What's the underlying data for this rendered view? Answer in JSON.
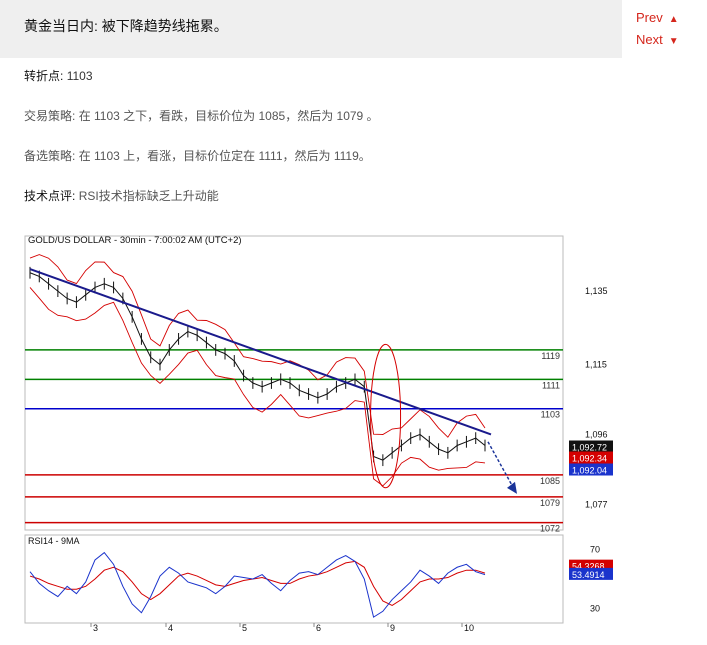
{
  "header": {
    "title": "黄金当日内: 被下降趋势线拖累。"
  },
  "nav": {
    "prev": "Prev",
    "next": "Next"
  },
  "pivot": {
    "label": "转折点:",
    "value": "1103"
  },
  "strategy": {
    "label": "交易策略:",
    "text": "在 1103 之下，看跌，目标价位为 1085，然后为 1079 。"
  },
  "alternative": {
    "label": "备选策略:",
    "text": "在 1103 上，看涨，目标价位定在 1111，然后为 1119。"
  },
  "comment": {
    "label": "技术点评:",
    "text": "RSI技术指标缺乏上升动能"
  },
  "chart_data": {
    "type": "line",
    "title": "GOLD/US DOLLAR - 30min - 7:00:02 AM (UTC+2)",
    "x_ticks": [
      "3",
      "4",
      "5",
      "6",
      "9",
      "10"
    ],
    "y_ticks": [
      1135,
      1115,
      1096,
      1077
    ],
    "ylim": [
      1070,
      1150
    ],
    "levels": [
      {
        "value": 1119,
        "label": "1119",
        "color": "#008000"
      },
      {
        "value": 1111,
        "label": "1111",
        "color": "#008000"
      },
      {
        "value": 1103,
        "label": "1103",
        "color": "#0000cc"
      },
      {
        "value": 1085,
        "label": "1085",
        "color": "#cc0000"
      },
      {
        "value": 1079,
        "label": "1079",
        "color": "#cc0000"
      },
      {
        "value": 1072,
        "label": "1072",
        "color": "#cc0000"
      }
    ],
    "price_tags": [
      {
        "value": 1092.72,
        "label": "1,092.72",
        "color": "#111111"
      },
      {
        "value": 1092.34,
        "label": "1,092.34",
        "color": "#d40000"
      },
      {
        "value": 1092.04,
        "label": "1,092.04",
        "color": "#1a33cc"
      }
    ],
    "close": [
      1140,
      1139,
      1137,
      1135,
      1133,
      1132,
      1134,
      1136,
      1137,
      1136,
      1133,
      1128,
      1122,
      1117,
      1115,
      1119,
      1122,
      1124,
      1123,
      1121,
      1119,
      1118,
      1116,
      1112,
      1110,
      1109,
      1110,
      1111,
      1110,
      1108,
      1107,
      1106,
      1107,
      1109,
      1110,
      1111,
      1109,
      1090,
      1089,
      1091,
      1093,
      1095,
      1096,
      1094,
      1092,
      1091,
      1093,
      1094,
      1095,
      1093
    ],
    "trendline": {
      "start": [
        0,
        1141
      ],
      "end": [
        49,
        1096
      ]
    },
    "rsi": {
      "title": "RSI14 - 9MA",
      "ylim": [
        20,
        80
      ],
      "ticks": [
        70,
        30
      ],
      "rsi_tag": {
        "value": 53.4914,
        "label": "53.4914"
      },
      "ma_tag": {
        "value": 54.3268,
        "label": "54.3268"
      },
      "rsi_values": [
        55,
        47,
        42,
        38,
        45,
        40,
        48,
        63,
        68,
        60,
        45,
        33,
        27,
        38,
        52,
        58,
        54,
        48,
        46,
        44,
        40,
        45,
        52,
        51,
        50,
        53,
        47,
        42,
        49,
        54,
        55,
        53,
        58,
        63,
        66,
        62,
        50,
        24,
        28,
        36,
        42,
        48,
        56,
        52,
        47,
        54,
        58,
        60,
        55,
        53
      ],
      "ma_values": [
        52,
        50,
        47,
        45,
        43,
        43,
        45,
        50,
        56,
        58,
        55,
        48,
        40,
        36,
        40,
        46,
        52,
        54,
        52,
        49,
        46,
        45,
        47,
        49,
        50,
        51,
        49,
        47,
        47,
        50,
        52,
        53,
        55,
        58,
        61,
        62,
        58,
        45,
        35,
        32,
        36,
        42,
        48,
        50,
        50,
        51,
        54,
        56,
        56,
        54
      ]
    }
  }
}
